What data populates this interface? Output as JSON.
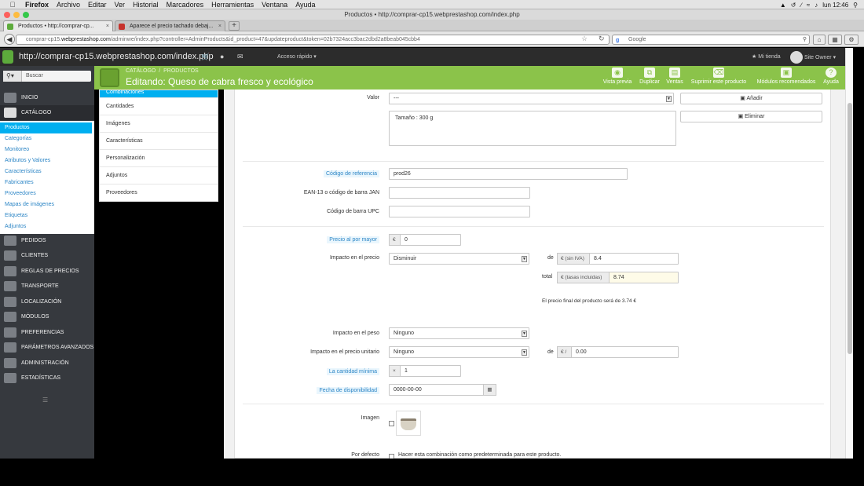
{
  "os_menubar": {
    "app": "Firefox",
    "items": [
      "Archivo",
      "Editar",
      "Ver",
      "Historial",
      "Marcadores",
      "Herramientas",
      "Ventana",
      "Ayuda"
    ],
    "clock": "lun 12:46"
  },
  "window_title": "Productos • http://comprar-cp15.webprestashop.com/index.php",
  "browser_tabs": [
    {
      "label": "Productos • http://comprar-cp..."
    },
    {
      "label": "Aparece el precio tachado debaj..."
    }
  ],
  "address_bar": {
    "url_prefix": "comprar-cp15.",
    "url_domain": "webprestashop.com",
    "url_rest": "/adminwe/index.php?controller=AdminProducts&id_product=47&updateproduct&token=02b7324acc3bac2dbd2a8beab045cbb4"
  },
  "search_engine": "Google",
  "admin_topbar": {
    "site_url": "http://comprar-cp15.webprestashop.com/index.php",
    "quick_access": "Acceso rápido",
    "my_store": "Mi tienda",
    "user": "Site Owner"
  },
  "sidebar": {
    "search_placeholder": "Buscar",
    "menu_top": [
      {
        "label": "Inicio"
      },
      {
        "label": "Catálogo"
      }
    ],
    "catalog_submenu": [
      {
        "label": "Productos"
      },
      {
        "label": "Categorías"
      },
      {
        "label": "Monitoreo"
      },
      {
        "label": "Atributos y Valores"
      },
      {
        "label": "Características"
      },
      {
        "label": "Fabricantes"
      },
      {
        "label": "Proveedores"
      },
      {
        "label": "Mapas de imágenes"
      },
      {
        "label": "Etiquetas"
      },
      {
        "label": "Adjuntos"
      }
    ],
    "menu_bottom": [
      {
        "label": "Pedidos"
      },
      {
        "label": "Clientes"
      },
      {
        "label": "Reglas de precios"
      },
      {
        "label": "Transporte"
      },
      {
        "label": "Localización"
      },
      {
        "label": "Módulos"
      },
      {
        "label": "Preferencias"
      },
      {
        "label": "Parámetros avanzados"
      },
      {
        "label": "Administración"
      },
      {
        "label": "Estadísticas"
      }
    ]
  },
  "header": {
    "breadcrumb_1": "CATÁLOGO",
    "breadcrumb_2": "PRODUCTOS",
    "title": "Editando: Queso de cabra fresco y ecológico",
    "actions": [
      {
        "label": "Vista previa"
      },
      {
        "label": "Duplicar"
      },
      {
        "label": "Ventas"
      },
      {
        "label": "Suprimir este producto"
      },
      {
        "label": "Módulos recomendados"
      },
      {
        "label": "Ayuda"
      }
    ]
  },
  "product_tabs": [
    {
      "label": "Combinaciones"
    },
    {
      "label": "Cantidades"
    },
    {
      "label": "Imágenes"
    },
    {
      "label": "Características"
    },
    {
      "label": "Personalización"
    },
    {
      "label": "Adjuntos"
    },
    {
      "label": "Proveedores"
    }
  ],
  "form": {
    "valor_label": "Valor",
    "valor_value": "---",
    "add_button": "Añadir",
    "delete_button": "Eliminar",
    "attributes_list": "Tamaño : 300 g",
    "reference_label": "Código de referencia",
    "reference_value": "prod26",
    "ean_label": "EAN-13 o código de barra JAN",
    "ean_value": "",
    "upc_label": "Código de barra UPC",
    "upc_value": "",
    "wholesale_label": "Precio al por mayor",
    "currency_symbol": "€",
    "wholesale_value": "0",
    "price_impact_label": "Impacto en el precio",
    "price_impact_value": "Disminuir",
    "de_label": "de",
    "tax_excl_addon": "€ (sin IVA)",
    "tax_excl_value": "8.4",
    "total_label": "total",
    "tax_incl_addon": "€ (tasas incluidas)",
    "tax_incl_value": "8.74",
    "final_price_text": "El precio final del producto será de 3.74 €",
    "weight_impact_label": "Impacto en el peso",
    "weight_impact_value": "Ninguno",
    "unit_impact_label": "Impacto en el precio unitario",
    "unit_impact_value": "Ninguno",
    "unit_addon": "€ /",
    "unit_value": "0.00",
    "min_qty_label": "La cantidad mínima",
    "min_qty_addon": "×",
    "min_qty_value": "1",
    "availability_label": "Fecha de disponibilidad",
    "availability_value": "0000-00-00",
    "image_label": "Imagen",
    "default_label": "Por defecto",
    "default_text": "Hacer esta combinación como predeterminada para este producto."
  }
}
